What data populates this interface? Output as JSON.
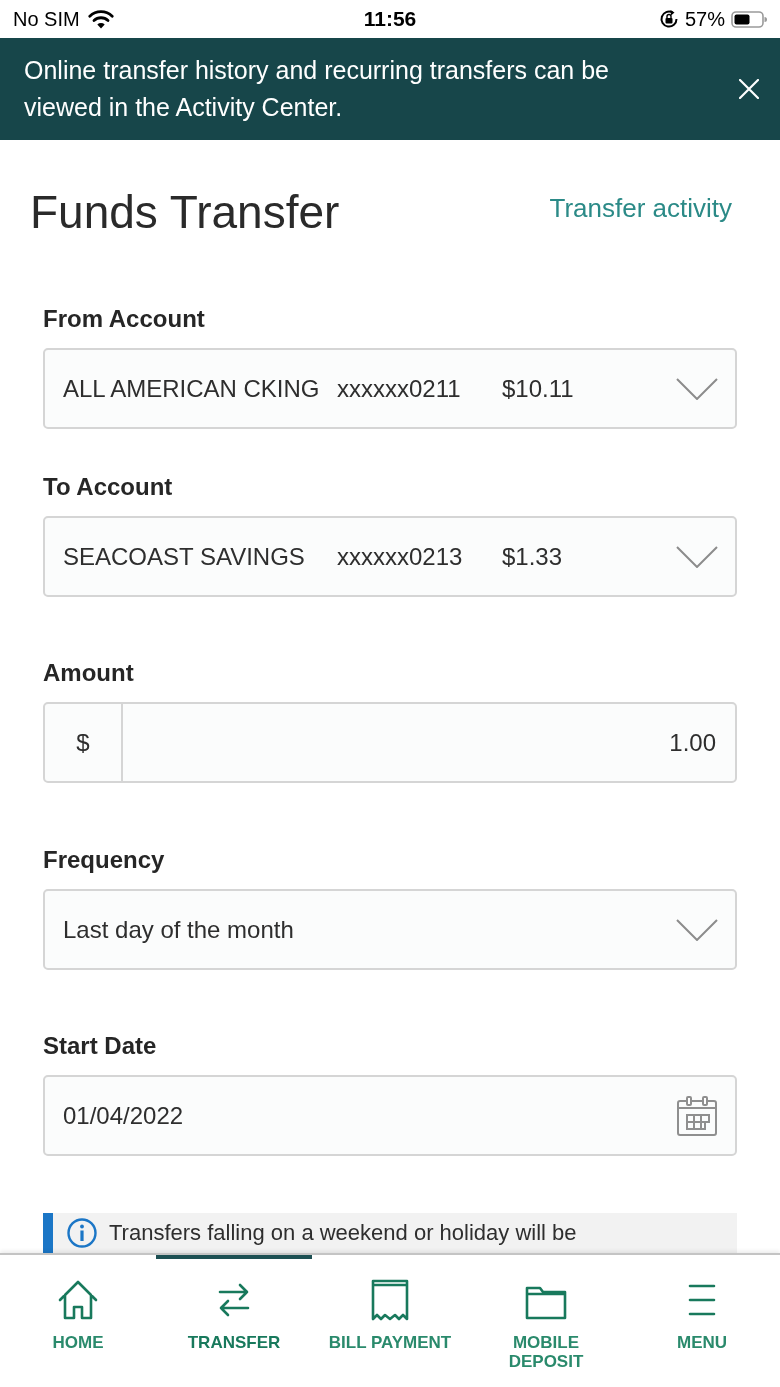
{
  "status_bar": {
    "carrier": "No SIM",
    "time": "11:56",
    "battery": "57%"
  },
  "banner": {
    "message": "Online transfer history and recurring transfers can be viewed in the Activity Center."
  },
  "header": {
    "title": "Funds Transfer",
    "link": "Transfer activity"
  },
  "fields": [
    {
      "kind": "account",
      "label": "From Account",
      "name": "ALL AMERICAN CKING",
      "number": "xxxxxx0211",
      "balance": "$10.11"
    },
    {
      "kind": "account",
      "label": "To Account",
      "name": "SEACOAST SAVINGS",
      "number": "xxxxxx0213",
      "balance": "$1.33"
    },
    {
      "kind": "amount",
      "label": "Amount",
      "prefix": "$",
      "value": "1.00"
    },
    {
      "kind": "select",
      "label": "Frequency",
      "value": "Last day of the month"
    },
    {
      "kind": "date",
      "label": "Start Date",
      "value": "01/04/2022"
    }
  ],
  "notice": {
    "text": "Transfers falling on a weekend or holiday will be"
  },
  "tabs": [
    {
      "kind": "home",
      "label": "HOME",
      "selected": false
    },
    {
      "kind": "transfer",
      "label": "TRANSFER",
      "selected": true
    },
    {
      "kind": "bill",
      "label": "BILL PAYMENT",
      "selected": false
    },
    {
      "kind": "deposit",
      "label": "MOBILE DEPOSIT",
      "selected": false
    },
    {
      "kind": "menu",
      "label": "MENU",
      "selected": false
    }
  ]
}
